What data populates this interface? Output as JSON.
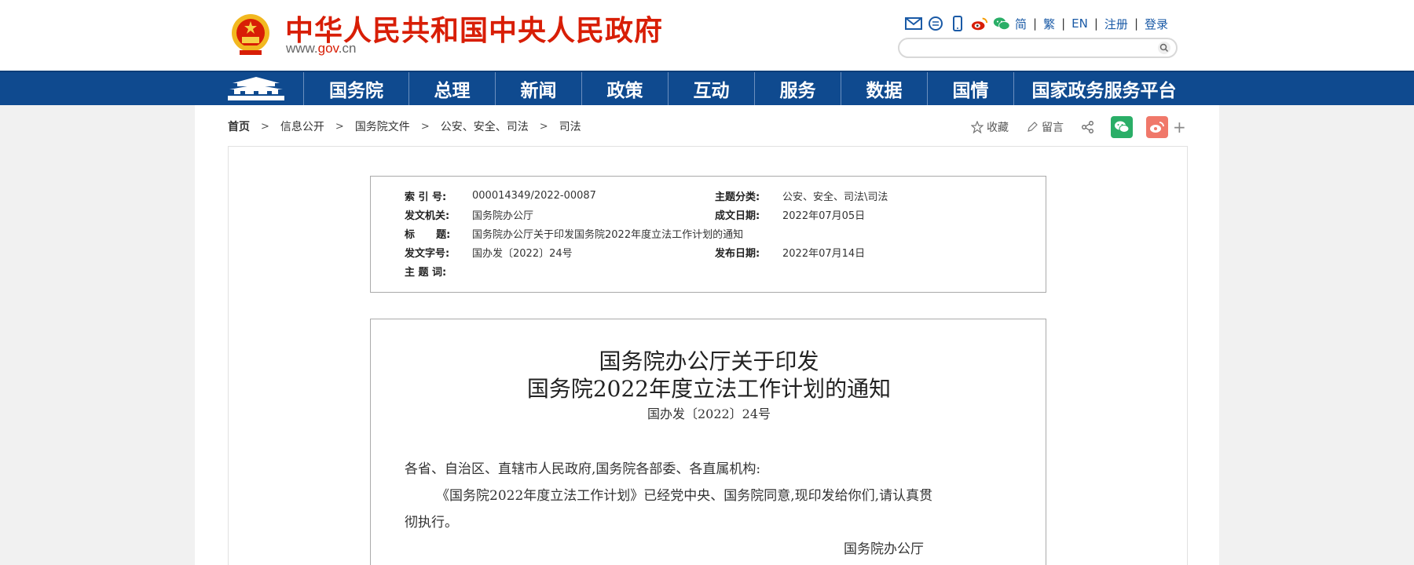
{
  "header": {
    "site_title": "中华人民共和国中央人民政府",
    "site_url_prefix": "www.",
    "site_url_gov": "gov",
    "site_url_suffix": ".cn",
    "util_links": [
      "简",
      "繁",
      "EN",
      "注册",
      "登录"
    ],
    "util_sep": "|",
    "search_placeholder": ""
  },
  "nav": {
    "items": [
      "国务院",
      "总理",
      "新闻",
      "政策",
      "互动",
      "服务",
      "数据",
      "国情",
      "国家政务服务平台"
    ]
  },
  "breadcrumb": {
    "items": [
      "首页",
      "信息公开",
      "国务院文件",
      "公安、安全、司法",
      "司法"
    ],
    "separator": ">"
  },
  "tools": {
    "favorite": "收藏",
    "comment": "留言",
    "plus": "+"
  },
  "info": {
    "index_label": "索 引 号:",
    "index_value": "000014349/2022-00087",
    "category_label": "主题分类:",
    "category_value": "公安、安全、司法\\司法",
    "issuer_label": "发文机关:",
    "issuer_value": "国务院办公厅",
    "written_label": "成文日期:",
    "written_value": "2022年07月05日",
    "title_label": "标      题:",
    "title_value": "国务院办公厅关于印发国务院2022年度立法工作计划的通知",
    "docno_label": "发文字号:",
    "docno_value": "国办发〔2022〕24号",
    "published_label": "发布日期:",
    "published_value": "2022年07月14日",
    "keywords_label": "主 题 词:",
    "keywords_value": ""
  },
  "document": {
    "title_line1": "国务院办公厅关于印发",
    "title_line2": "国务院2022年度立法工作计划的通知",
    "doc_number": "国办发〔2022〕24号",
    "salutation": "各省、自治区、直辖市人民政府,国务院各部委、各直属机构:",
    "body_line1": "《国务院2022年度立法工作计划》已经党中央、国务院同意,现印发给你们,请认真贯",
    "body_line2": "彻执行。",
    "signature": "国务院办公厅"
  },
  "colors": {
    "brand_red": "#d81e06",
    "nav_blue": "#0f4a8f",
    "link_blue": "#1a5aa6",
    "wechat_green": "#2aae67",
    "weibo_red": "#f0786a"
  },
  "icons": [
    "national-emblem-icon",
    "mail-icon",
    "chat-icon",
    "mobile-icon",
    "weibo-icon",
    "wechat-icon",
    "search-icon",
    "tiananmen-icon",
    "star-icon",
    "pencil-icon",
    "share-icon"
  ]
}
